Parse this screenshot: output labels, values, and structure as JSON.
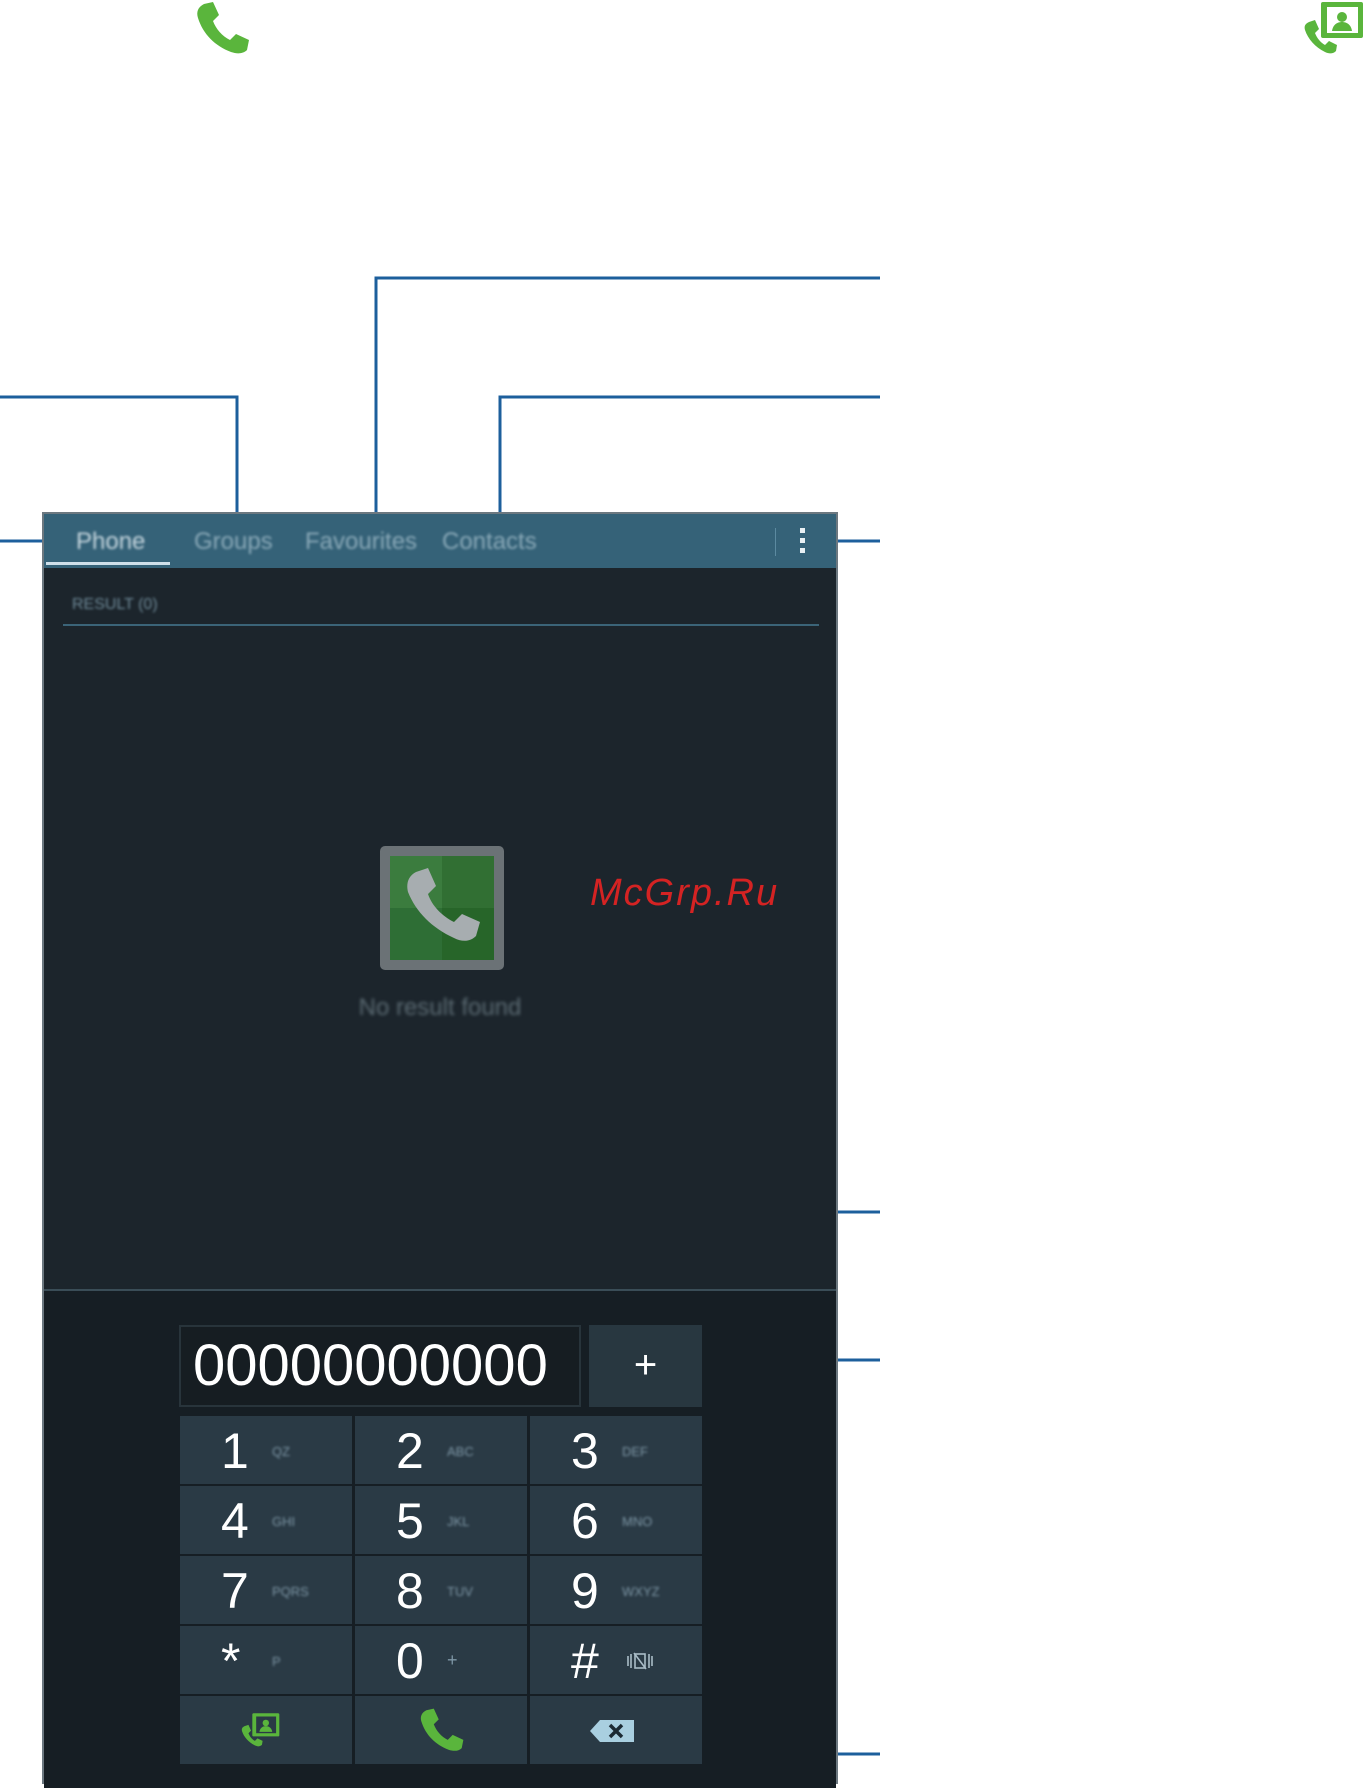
{
  "tabs": [
    {
      "label": "Phone"
    },
    {
      "label": "Groups"
    },
    {
      "label": "Favourites"
    },
    {
      "label": "Contacts"
    }
  ],
  "log_header": "RESULT (0)",
  "empty_state": "No result found",
  "watermark": "McGrp.Ru",
  "dialer": {
    "number": "00000000000",
    "add_label": "+",
    "keys": [
      {
        "digit": "1",
        "letters": "QZ"
      },
      {
        "digit": "2",
        "letters": "ABC"
      },
      {
        "digit": "3",
        "letters": "DEF"
      },
      {
        "digit": "4",
        "letters": "GHI"
      },
      {
        "digit": "5",
        "letters": "JKL"
      },
      {
        "digit": "6",
        "letters": "MNO"
      },
      {
        "digit": "7",
        "letters": "PQRS"
      },
      {
        "digit": "8",
        "letters": "TUV"
      },
      {
        "digit": "9",
        "letters": "WXYZ"
      },
      {
        "digit": "*",
        "letters": "P"
      },
      {
        "digit": "0",
        "letters": "+"
      },
      {
        "digit": "#",
        "letters": ""
      }
    ],
    "actions": {
      "left_icon": "contacts-icon",
      "center_icon": "call-icon",
      "right_icon": "backspace-icon"
    }
  },
  "colors": {
    "accent_green": "#5ab53c",
    "tab_bar": "#356278",
    "callout": "#1d5f9c"
  }
}
